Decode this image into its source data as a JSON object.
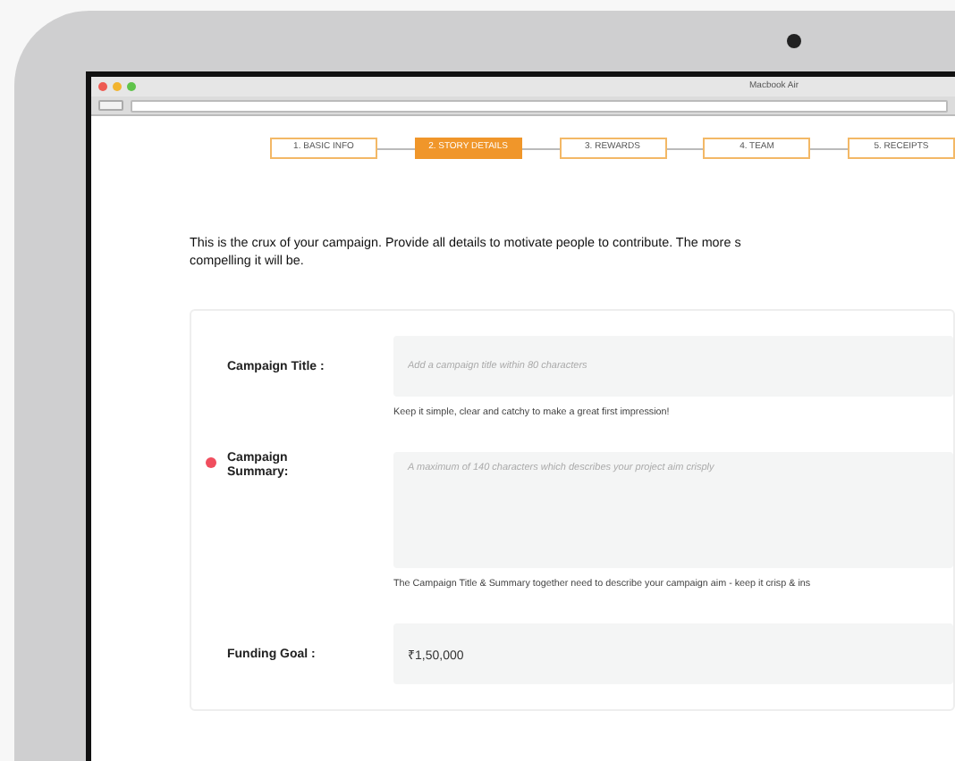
{
  "window": {
    "title": "Macbook Air"
  },
  "steps": [
    {
      "label": "1. BASIC INFO",
      "selected": false
    },
    {
      "label": "2. STORY DETAILS",
      "selected": true
    },
    {
      "label": "3. REWARDS",
      "selected": false
    },
    {
      "label": "4. TEAM",
      "selected": false
    },
    {
      "label": "5. RECEIPTS",
      "selected": false
    }
  ],
  "intro": [
    "This is the crux of your campaign. Provide all details to motivate people to contribute. The more s",
    "compelling it will be."
  ],
  "fields": [
    {
      "kind": "input",
      "label": "Campaign Title :",
      "placeholder": "Add a campaign title within 80 characters",
      "hint": "Keep it simple, clear and catchy to make a great first impression!",
      "flagged": false
    },
    {
      "kind": "textarea",
      "label": "Campaign Summary:",
      "placeholder": "A maximum of 140 characters which describes your project aim crisply",
      "hint": "The Campaign Title & Summary together need to describe your campaign aim - keep it crisp & ins",
      "flagged": true
    },
    {
      "kind": "input",
      "label": "Funding Goal :",
      "value": "₹1,50,000",
      "flagged": false
    }
  ]
}
